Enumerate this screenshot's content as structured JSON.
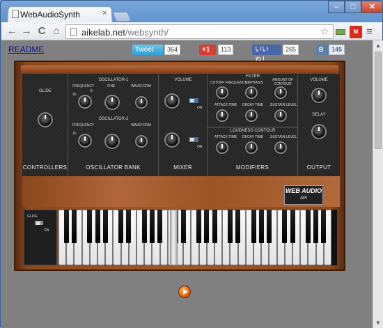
{
  "browser": {
    "tab_title": "WebAudioSynth",
    "tab_close": "×",
    "url_host": "aikelab.net",
    "url_path": "/websynth/",
    "back": "←",
    "forward": "→",
    "reload": "C",
    "home": "⌂",
    "bookmark_star": "☆",
    "menu": "≡",
    "ext_badge": "M",
    "win_min": "–",
    "win_max": "□",
    "win_close": "✕"
  },
  "page": {
    "readme": "README",
    "social": {
      "tweet_label": "Tweet",
      "tweet_count": "364",
      "gplus_label": "+1",
      "gplus_count": "113",
      "fb_label": "いいね！",
      "fb_count": "265",
      "vk_label": "B",
      "vk_count": "145"
    }
  },
  "synth": {
    "controllers": {
      "title": "CONTROLLERS",
      "glide": "GLIDE"
    },
    "osc_bank": {
      "title": "OSCILLATOR BANK",
      "osc1": "OSCILLATOR-1",
      "osc2": "OSCILLATOR-2",
      "frequency": "FREQUENCY",
      "fine": "FINE",
      "waveform": "WAVEFORM",
      "freq_low": "16",
      "freq_high": "8"
    },
    "mixer": {
      "title": "MIXER",
      "volume": "VOLUME",
      "on1": "ON",
      "on2": "ON"
    },
    "modifiers": {
      "title": "MODIFIERS",
      "filter": "FILTER",
      "cutoff": "CUTOFF FREQUENCY",
      "emphasis": "EMPHASIS",
      "amount": "AMOUNT OF CONTOUR",
      "attack": "ATTACK TIME",
      "decay": "DECAY TIME",
      "sustain": "SUSTAIN LEVEL",
      "loudness": "LOUDNESS CONTOUR",
      "l_attack": "ATTACK TIME",
      "l_decay": "DECAY TIME",
      "l_sustain": "SUSTAIN LEVEL"
    },
    "output": {
      "title": "OUTPUT",
      "volume": "VOLUME",
      "delay": "DELAY"
    },
    "badge_title": "WEB AUDIO",
    "badge_sub": "API",
    "glide_switch_label": "GLIDE",
    "glide_switch_on": "ON"
  },
  "colors": {
    "accent_switch": "#4a6ea0",
    "play": "#e2640e"
  }
}
